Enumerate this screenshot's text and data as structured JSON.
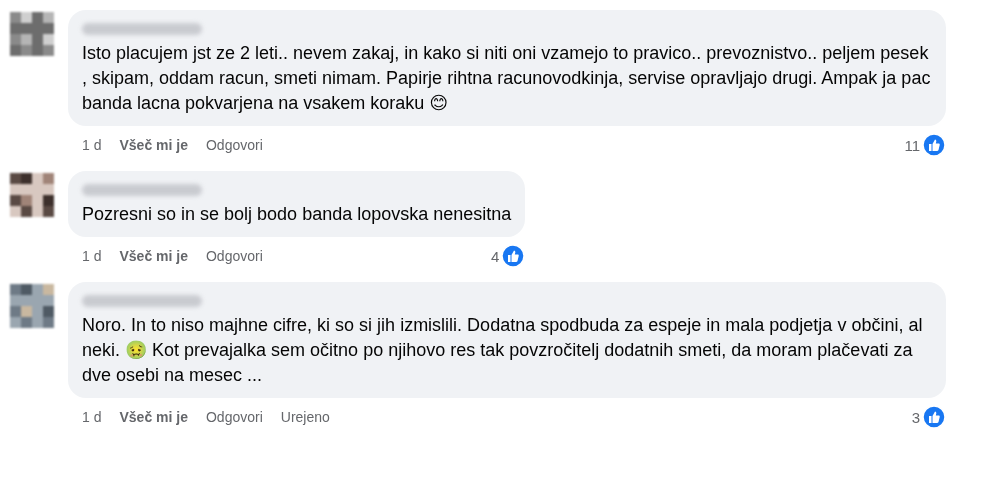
{
  "comments": [
    {
      "segments": [
        {
          "kind": "text",
          "text": "Isto placujem jst ze 2 leti.. nevem zakaj, in kako si niti oni vzamejo to pravico.. prevoznistvo.. peljem pesek , skipam, oddam racun, smeti nimam. Papirje rihtna racunovodkinja, servise opravljajo drugi. Ampak ja pac banda lacna pokvarjena na vsakem koraku 😊"
        }
      ],
      "time": "1 d",
      "like": "Všeč mi je",
      "reply": "Odgovori",
      "reactions": "11"
    },
    {
      "segments": [
        {
          "kind": "text",
          "text": "Pozresni so in se bolj bodo banda lopovska nenesitna"
        }
      ],
      "time": "1 d",
      "like": "Všeč mi je",
      "reply": "Odgovori",
      "reactions": "4"
    },
    {
      "segments": [
        {
          "kind": "text",
          "text": "Noro. In to niso majhne cifre, ki so si jih izmislili. Dodatna spodbuda za espeje in mala podjetja v občini, al neki. 🤢 Kot prevajalka sem očitno po njihovo res tak povzročitelj dodatnih smeti, da moram plačevati za dve osebi na mesec ..."
        }
      ],
      "time": "1 d",
      "like": "Všeč mi je",
      "reply": "Odgovori",
      "edited": "Urejeno",
      "reactions": "3"
    }
  ]
}
